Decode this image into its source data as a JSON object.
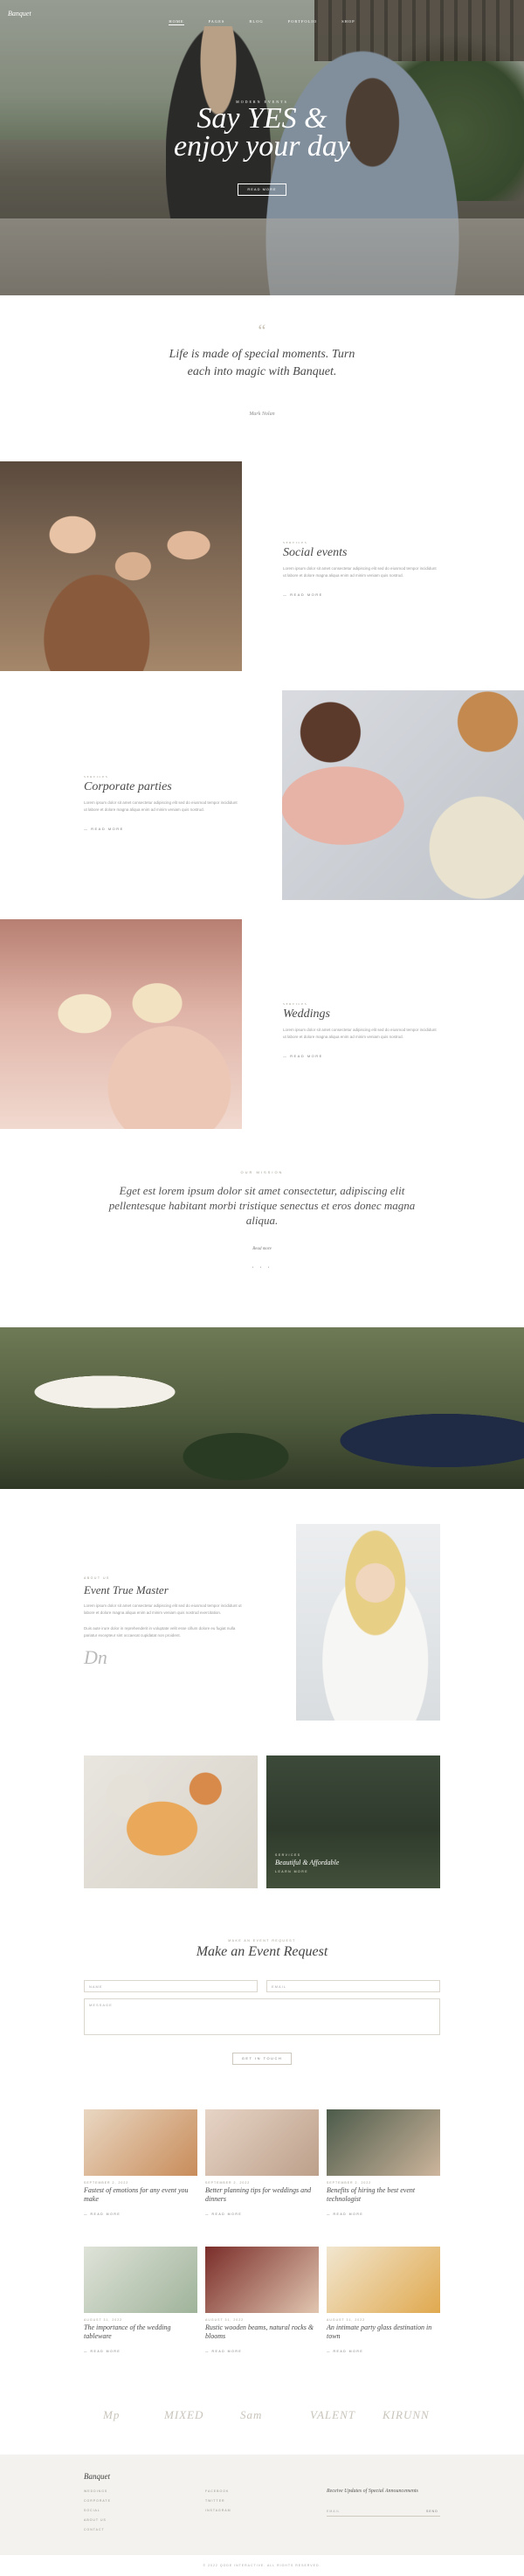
{
  "header": {
    "logo": "Banquet",
    "nav": [
      "Home",
      "Pages",
      "Blog",
      "Portfolio",
      "Shop"
    ]
  },
  "hero": {
    "kicker": "Modern Events",
    "title_line1": "Say YES &",
    "title_line2": "enjoy your day",
    "button": "Read More"
  },
  "quote": {
    "mark": "“",
    "text": "Life is made of special moments. Turn each into magic with Banquet.",
    "author": "Mark Nolan"
  },
  "services": [
    {
      "kicker": "Services",
      "title": "Social events",
      "desc": "Lorem ipsum dolor sit amet consectetur adipiscing elit sed do eiusmod tempor incididunt ut labore et dolore magna aliqua enim ad minim veniam quis nostrud.",
      "more": "Read More"
    },
    {
      "kicker": "Services",
      "title": "Corporate parties",
      "desc": "Lorem ipsum dolor sit amet consectetur adipiscing elit sed do eiusmod tempor incididunt ut labore et dolore magna aliqua enim ad minim veniam quis nostrud.",
      "more": "Read More"
    },
    {
      "kicker": "Services",
      "title": "Weddings",
      "desc": "Lorem ipsum dolor sit amet consectetur adipiscing elit sed do eiusmod tempor incididunt ut labore et dolore magna aliqua enim ad minim veniam quis nostrud.",
      "more": "Read More"
    }
  ],
  "mission": {
    "kicker": "Our Mission",
    "text": "Eget est lorem ipsum dolor sit amet consectetur, adipiscing elit pellentesque habitant morbi tristique senectus et eros donec magna aliqua.",
    "link": "Read more",
    "dots": "• • •"
  },
  "master": {
    "kicker": "About Us",
    "title": "Event True Master",
    "desc1": "Lorem ipsum dolor sit amet consectetur adipiscing elit sed do eiusmod tempor incididunt ut labore et dolore magna aliqua enim ad minim veniam quis nostrud exercitation.",
    "desc2": "Duis aute irure dolor in reprehenderit in voluptate velit esse cillum dolore eu fugiat nulla pariatur excepteur sint occaecat cupidatat non proident.",
    "signature": "Dn"
  },
  "duo": {
    "sub": "Services",
    "title": "Beautiful & Affordable",
    "tag": "Learn More"
  },
  "request": {
    "kicker": "Make an Event Request",
    "title": "Make an Event Request",
    "name_placeholder": "Name",
    "email_placeholder": "Email",
    "message_placeholder": "Message",
    "send": "Get in Touch"
  },
  "blog": [
    {
      "date": "September 2, 2022",
      "title": "Fastest of emotions for any event you make",
      "more": "Read More"
    },
    {
      "date": "September 2, 2022",
      "title": "Better planning tips for weddings and dinners",
      "more": "Read More"
    },
    {
      "date": "September 2, 2022",
      "title": "Benefits of hiring the best event technologist",
      "more": "Read More"
    },
    {
      "date": "August 31, 2022",
      "title": "The importance of the wedding tableware",
      "more": "Read More"
    },
    {
      "date": "August 31, 2022",
      "title": "Rustic wooden beams, natural rocks & blooms",
      "more": "Read More"
    },
    {
      "date": "August 31, 2022",
      "title": "An intimate party glass destination in town",
      "more": "Read More"
    }
  ],
  "logos": [
    "Mp",
    "MIXED",
    "Sam",
    "VALENT",
    "KIRUNN"
  ],
  "footer": {
    "brand": "Banquet",
    "col1": [
      "Weddings",
      "Corporate",
      "Social",
      "About Us",
      "Contact"
    ],
    "col2": [
      "Facebook",
      "Twitter",
      "Instagram"
    ],
    "newsletter": "Receive Updates of Special Announcements",
    "email_placeholder": "Email",
    "send": "Send",
    "copyright": "© 2022 Qode Interactive. All rights reserved."
  }
}
